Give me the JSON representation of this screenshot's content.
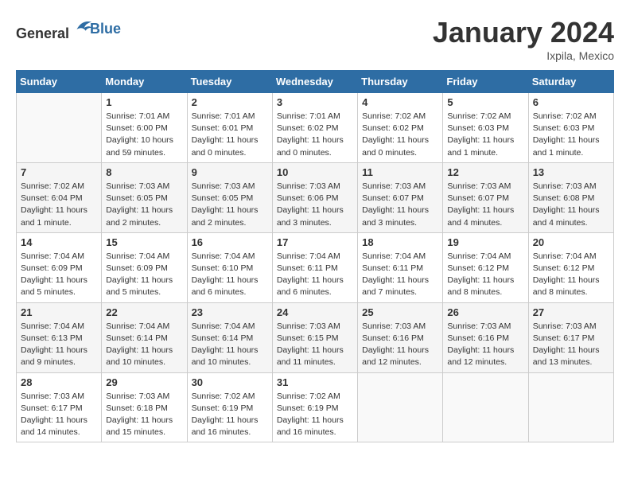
{
  "header": {
    "logo_general": "General",
    "logo_blue": "Blue",
    "title": "January 2024",
    "location": "Ixpila, Mexico"
  },
  "weekdays": [
    "Sunday",
    "Monday",
    "Tuesday",
    "Wednesday",
    "Thursday",
    "Friday",
    "Saturday"
  ],
  "weeks": [
    [
      {
        "day": "",
        "info": ""
      },
      {
        "day": "1",
        "info": "Sunrise: 7:01 AM\nSunset: 6:00 PM\nDaylight: 10 hours\nand 59 minutes."
      },
      {
        "day": "2",
        "info": "Sunrise: 7:01 AM\nSunset: 6:01 PM\nDaylight: 11 hours\nand 0 minutes."
      },
      {
        "day": "3",
        "info": "Sunrise: 7:01 AM\nSunset: 6:02 PM\nDaylight: 11 hours\nand 0 minutes."
      },
      {
        "day": "4",
        "info": "Sunrise: 7:02 AM\nSunset: 6:02 PM\nDaylight: 11 hours\nand 0 minutes."
      },
      {
        "day": "5",
        "info": "Sunrise: 7:02 AM\nSunset: 6:03 PM\nDaylight: 11 hours\nand 1 minute."
      },
      {
        "day": "6",
        "info": "Sunrise: 7:02 AM\nSunset: 6:03 PM\nDaylight: 11 hours\nand 1 minute."
      }
    ],
    [
      {
        "day": "7",
        "info": "Sunrise: 7:02 AM\nSunset: 6:04 PM\nDaylight: 11 hours\nand 1 minute."
      },
      {
        "day": "8",
        "info": "Sunrise: 7:03 AM\nSunset: 6:05 PM\nDaylight: 11 hours\nand 2 minutes."
      },
      {
        "day": "9",
        "info": "Sunrise: 7:03 AM\nSunset: 6:05 PM\nDaylight: 11 hours\nand 2 minutes."
      },
      {
        "day": "10",
        "info": "Sunrise: 7:03 AM\nSunset: 6:06 PM\nDaylight: 11 hours\nand 3 minutes."
      },
      {
        "day": "11",
        "info": "Sunrise: 7:03 AM\nSunset: 6:07 PM\nDaylight: 11 hours\nand 3 minutes."
      },
      {
        "day": "12",
        "info": "Sunrise: 7:03 AM\nSunset: 6:07 PM\nDaylight: 11 hours\nand 4 minutes."
      },
      {
        "day": "13",
        "info": "Sunrise: 7:03 AM\nSunset: 6:08 PM\nDaylight: 11 hours\nand 4 minutes."
      }
    ],
    [
      {
        "day": "14",
        "info": "Sunrise: 7:04 AM\nSunset: 6:09 PM\nDaylight: 11 hours\nand 5 minutes."
      },
      {
        "day": "15",
        "info": "Sunrise: 7:04 AM\nSunset: 6:09 PM\nDaylight: 11 hours\nand 5 minutes."
      },
      {
        "day": "16",
        "info": "Sunrise: 7:04 AM\nSunset: 6:10 PM\nDaylight: 11 hours\nand 6 minutes."
      },
      {
        "day": "17",
        "info": "Sunrise: 7:04 AM\nSunset: 6:11 PM\nDaylight: 11 hours\nand 6 minutes."
      },
      {
        "day": "18",
        "info": "Sunrise: 7:04 AM\nSunset: 6:11 PM\nDaylight: 11 hours\nand 7 minutes."
      },
      {
        "day": "19",
        "info": "Sunrise: 7:04 AM\nSunset: 6:12 PM\nDaylight: 11 hours\nand 8 minutes."
      },
      {
        "day": "20",
        "info": "Sunrise: 7:04 AM\nSunset: 6:12 PM\nDaylight: 11 hours\nand 8 minutes."
      }
    ],
    [
      {
        "day": "21",
        "info": "Sunrise: 7:04 AM\nSunset: 6:13 PM\nDaylight: 11 hours\nand 9 minutes."
      },
      {
        "day": "22",
        "info": "Sunrise: 7:04 AM\nSunset: 6:14 PM\nDaylight: 11 hours\nand 10 minutes."
      },
      {
        "day": "23",
        "info": "Sunrise: 7:04 AM\nSunset: 6:14 PM\nDaylight: 11 hours\nand 10 minutes."
      },
      {
        "day": "24",
        "info": "Sunrise: 7:03 AM\nSunset: 6:15 PM\nDaylight: 11 hours\nand 11 minutes."
      },
      {
        "day": "25",
        "info": "Sunrise: 7:03 AM\nSunset: 6:16 PM\nDaylight: 11 hours\nand 12 minutes."
      },
      {
        "day": "26",
        "info": "Sunrise: 7:03 AM\nSunset: 6:16 PM\nDaylight: 11 hours\nand 12 minutes."
      },
      {
        "day": "27",
        "info": "Sunrise: 7:03 AM\nSunset: 6:17 PM\nDaylight: 11 hours\nand 13 minutes."
      }
    ],
    [
      {
        "day": "28",
        "info": "Sunrise: 7:03 AM\nSunset: 6:17 PM\nDaylight: 11 hours\nand 14 minutes."
      },
      {
        "day": "29",
        "info": "Sunrise: 7:03 AM\nSunset: 6:18 PM\nDaylight: 11 hours\nand 15 minutes."
      },
      {
        "day": "30",
        "info": "Sunrise: 7:02 AM\nSunset: 6:19 PM\nDaylight: 11 hours\nand 16 minutes."
      },
      {
        "day": "31",
        "info": "Sunrise: 7:02 AM\nSunset: 6:19 PM\nDaylight: 11 hours\nand 16 minutes."
      },
      {
        "day": "",
        "info": ""
      },
      {
        "day": "",
        "info": ""
      },
      {
        "day": "",
        "info": ""
      }
    ]
  ]
}
